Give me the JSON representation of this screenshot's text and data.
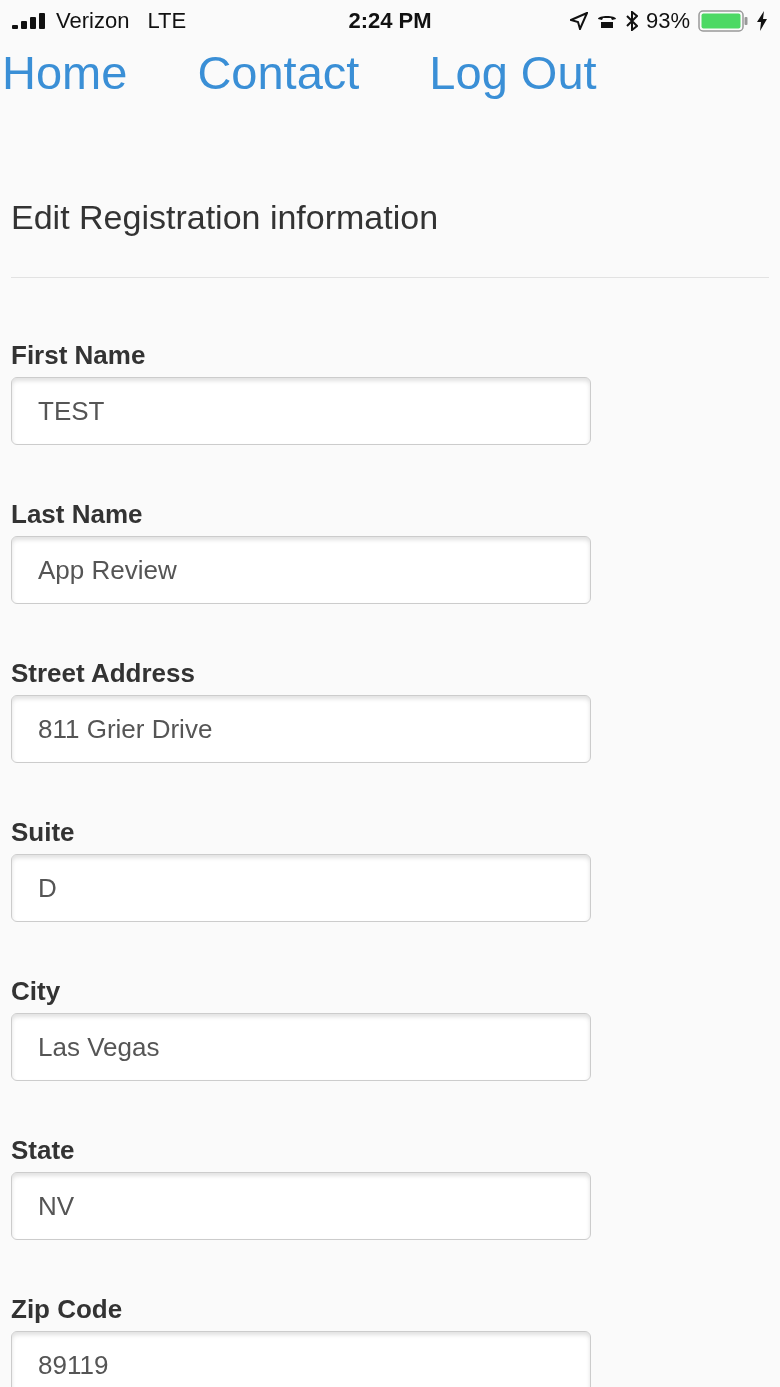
{
  "status_bar": {
    "carrier": "Verizon",
    "network": "LTE",
    "time": "2:24 PM",
    "battery": "93%"
  },
  "nav": [
    "Home",
    "Contact",
    "Log Out"
  ],
  "title": "Edit Registration information",
  "fields": [
    {
      "label": "First Name",
      "value": "TEST"
    },
    {
      "label": "Last Name",
      "value": "App Review"
    },
    {
      "label": "Street Address",
      "value": "811 Grier Drive"
    },
    {
      "label": "Suite",
      "value": "D"
    },
    {
      "label": "City",
      "value": "Las Vegas"
    },
    {
      "label": "State",
      "value": "NV"
    },
    {
      "label": "Zip Code",
      "value": "89119"
    }
  ]
}
